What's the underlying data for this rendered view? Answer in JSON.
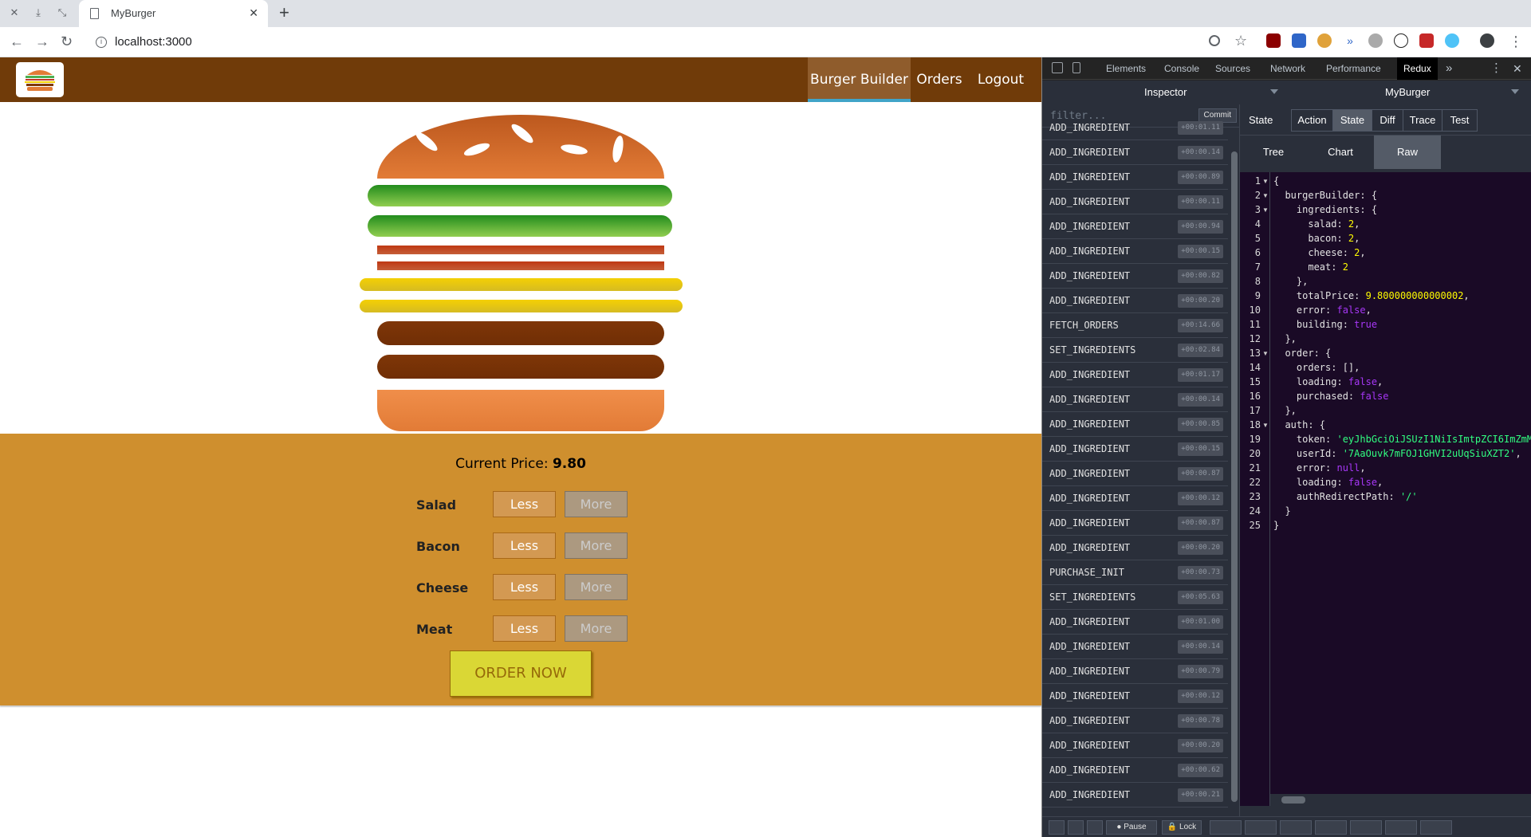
{
  "browser": {
    "tab_title": "MyBurger",
    "url": "localhost:3000",
    "new_tab": "+"
  },
  "app": {
    "nav": {
      "burger_builder": "Burger Builder",
      "orders": "Orders",
      "logout": "Logout"
    },
    "price_label": "Current Price:",
    "price_value": "9.80",
    "controls": [
      {
        "label": "Salad",
        "less": "Less",
        "more": "More"
      },
      {
        "label": "Bacon",
        "less": "Less",
        "more": "More"
      },
      {
        "label": "Cheese",
        "less": "Less",
        "more": "More"
      },
      {
        "label": "Meat",
        "less": "Less",
        "more": "More"
      }
    ],
    "order_button": "ORDER NOW",
    "colors": {
      "toolbar": "#703b09",
      "controls_bg": "#cf8f2e",
      "nav_active_border": "#40a4c8"
    }
  },
  "devtools": {
    "tabs": [
      "Elements",
      "Console",
      "Sources",
      "Network",
      "Performance",
      "Redux"
    ],
    "more": "»",
    "redux": {
      "monitor": "Inspector",
      "instance": "MyBurger",
      "filter_placeholder": "filter...",
      "commit": "Commit",
      "actions": [
        {
          "name": "ADD_INGREDIENT",
          "time": "+00:01.11"
        },
        {
          "name": "ADD_INGREDIENT",
          "time": "+00:00.14"
        },
        {
          "name": "ADD_INGREDIENT",
          "time": "+00:00.89"
        },
        {
          "name": "ADD_INGREDIENT",
          "time": "+00:00.11"
        },
        {
          "name": "ADD_INGREDIENT",
          "time": "+00:00.94"
        },
        {
          "name": "ADD_INGREDIENT",
          "time": "+00:00.15"
        },
        {
          "name": "ADD_INGREDIENT",
          "time": "+00:00.82"
        },
        {
          "name": "ADD_INGREDIENT",
          "time": "+00:00.20"
        },
        {
          "name": "FETCH_ORDERS",
          "time": "+00:14.66"
        },
        {
          "name": "SET_INGREDIENTS",
          "time": "+00:02.84"
        },
        {
          "name": "ADD_INGREDIENT",
          "time": "+00:01.17"
        },
        {
          "name": "ADD_INGREDIENT",
          "time": "+00:00.14"
        },
        {
          "name": "ADD_INGREDIENT",
          "time": "+00:00.85"
        },
        {
          "name": "ADD_INGREDIENT",
          "time": "+00:00.15"
        },
        {
          "name": "ADD_INGREDIENT",
          "time": "+00:00.87"
        },
        {
          "name": "ADD_INGREDIENT",
          "time": "+00:00.12"
        },
        {
          "name": "ADD_INGREDIENT",
          "time": "+00:00.87"
        },
        {
          "name": "ADD_INGREDIENT",
          "time": "+00:00.20"
        },
        {
          "name": "PURCHASE_INIT",
          "time": "+00:00.73"
        },
        {
          "name": "SET_INGREDIENTS",
          "time": "+00:05.63"
        },
        {
          "name": "ADD_INGREDIENT",
          "time": "+00:01.00"
        },
        {
          "name": "ADD_INGREDIENT",
          "time": "+00:00.14"
        },
        {
          "name": "ADD_INGREDIENT",
          "time": "+00:00.79"
        },
        {
          "name": "ADD_INGREDIENT",
          "time": "+00:00.12"
        },
        {
          "name": "ADD_INGREDIENT",
          "time": "+00:00.78"
        },
        {
          "name": "ADD_INGREDIENT",
          "time": "+00:00.20"
        },
        {
          "name": "ADD_INGREDIENT",
          "time": "+00:00.62"
        },
        {
          "name": "ADD_INGREDIENT",
          "time": "+00:00.21"
        }
      ],
      "state_label": "State",
      "state_buttons": [
        "Action",
        "State",
        "Diff",
        "Trace",
        "Test"
      ],
      "view_tabs": [
        "Tree",
        "Chart",
        "Raw"
      ],
      "code_lines": [
        [
          [
            "p",
            "{"
          ]
        ],
        [
          [
            "p",
            "  burgerBuilder: {"
          ]
        ],
        [
          [
            "p",
            "    ingredients: {"
          ]
        ],
        [
          [
            "p",
            "      salad: "
          ],
          [
            "n",
            "2"
          ],
          [
            "p",
            ","
          ]
        ],
        [
          [
            "p",
            "      bacon: "
          ],
          [
            "n",
            "2"
          ],
          [
            "p",
            ","
          ]
        ],
        [
          [
            "p",
            "      cheese: "
          ],
          [
            "n",
            "2"
          ],
          [
            "p",
            ","
          ]
        ],
        [
          [
            "p",
            "      meat: "
          ],
          [
            "n",
            "2"
          ]
        ],
        [
          [
            "p",
            "    },"
          ]
        ],
        [
          [
            "p",
            "    totalPrice: "
          ],
          [
            "n",
            "9.800000000000002"
          ],
          [
            "p",
            ","
          ]
        ],
        [
          [
            "p",
            "    error: "
          ],
          [
            "k",
            "false"
          ],
          [
            "p",
            ","
          ]
        ],
        [
          [
            "p",
            "    building: "
          ],
          [
            "k",
            "true"
          ]
        ],
        [
          [
            "p",
            "  },"
          ]
        ],
        [
          [
            "p",
            "  order: {"
          ]
        ],
        [
          [
            "p",
            "    orders: [],"
          ]
        ],
        [
          [
            "p",
            "    loading: "
          ],
          [
            "k",
            "false"
          ],
          [
            "p",
            ","
          ]
        ],
        [
          [
            "p",
            "    purchased: "
          ],
          [
            "k",
            "false"
          ]
        ],
        [
          [
            "p",
            "  },"
          ]
        ],
        [
          [
            "p",
            "  auth: {"
          ]
        ],
        [
          [
            "p",
            "    token: "
          ],
          [
            "s",
            "'eyJhbGciOiJSUzI1NiIsImtpZCI6ImZmM"
          ]
        ],
        [
          [
            "p",
            "    userId: "
          ],
          [
            "s",
            "'7AaOuvk7mFOJ1GHVI2uUqSiuXZT2'"
          ],
          [
            "p",
            ","
          ]
        ],
        [
          [
            "p",
            "    error: "
          ],
          [
            "k",
            "null"
          ],
          [
            "p",
            ","
          ]
        ],
        [
          [
            "p",
            "    loading: "
          ],
          [
            "k",
            "false"
          ],
          [
            "p",
            ","
          ]
        ],
        [
          [
            "p",
            "    authRedirectPath: "
          ],
          [
            "s",
            "'/'"
          ]
        ],
        [
          [
            "p",
            "  }"
          ]
        ],
        [
          [
            "p",
            "}"
          ]
        ]
      ],
      "bottom_buttons": [
        "Pause",
        "Lock"
      ]
    }
  }
}
